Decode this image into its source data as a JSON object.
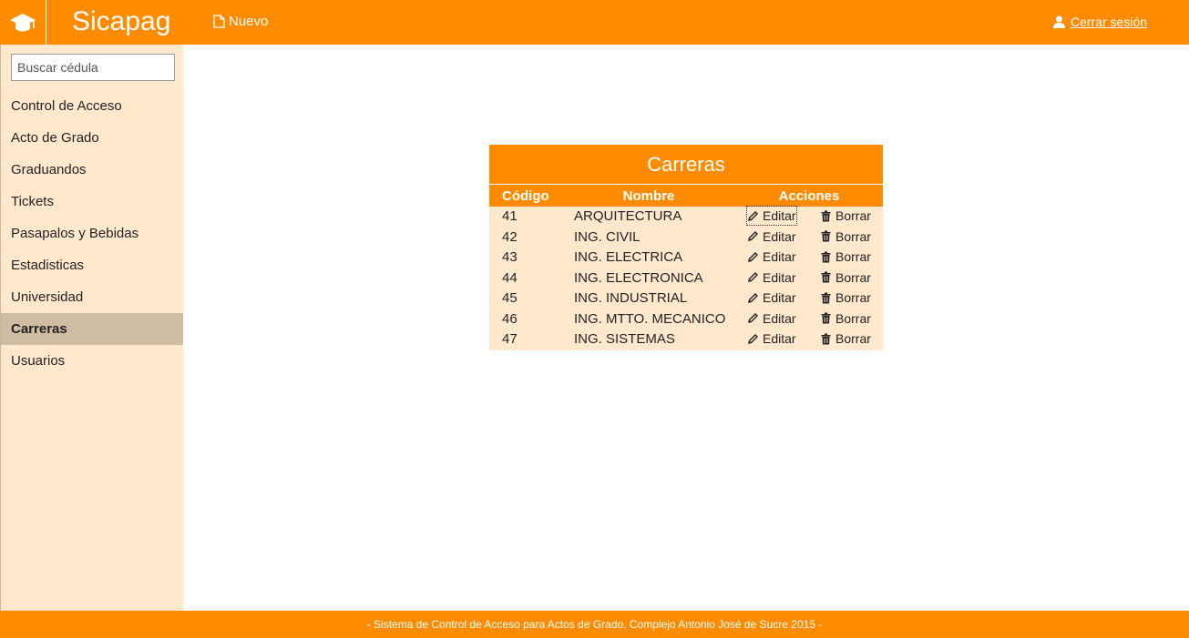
{
  "app": {
    "brand": "Sicapag"
  },
  "header": {
    "new_label": "Nuevo",
    "logout_label": "Cerrar sesión"
  },
  "search": {
    "placeholder": "Buscar cédula",
    "value": ""
  },
  "sidebar": {
    "items": [
      {
        "label": "Control de Acceso",
        "active": false
      },
      {
        "label": "Acto de Grado",
        "active": false
      },
      {
        "label": "Graduandos",
        "active": false
      },
      {
        "label": "Tickets",
        "active": false
      },
      {
        "label": "Pasapalos y Bebidas",
        "active": false
      },
      {
        "label": "Estadisticas",
        "active": false
      },
      {
        "label": "Universidad",
        "active": false
      },
      {
        "label": "Carreras",
        "active": true
      },
      {
        "label": "Usuarios",
        "active": false
      }
    ]
  },
  "table": {
    "title": "Carreras",
    "headers": {
      "code": "Código",
      "name": "Nombre",
      "actions": "Acciones"
    },
    "edit_label": "Editar",
    "delete_label": "Borrar",
    "rows": [
      {
        "code": "41",
        "name": "ARQUITECTURA"
      },
      {
        "code": "42",
        "name": "ING. CIVIL"
      },
      {
        "code": "43",
        "name": "ING. ELECTRICA"
      },
      {
        "code": "44",
        "name": "ING. ELECTRONICA"
      },
      {
        "code": "45",
        "name": "ING. INDUSTRIAL"
      },
      {
        "code": "46",
        "name": "ING. MTTO. MECANICO"
      },
      {
        "code": "47",
        "name": "ING. SISTEMAS"
      }
    ]
  },
  "footer": {
    "text": "- Sistema de Control de Acceso para Actos de Grado, Complejo Antonio José de Sucre 2015 -"
  },
  "colors": {
    "accent": "#ff8c00",
    "sidebar_bg": "#ffe8cc",
    "active_item": "#cfbca3"
  },
  "icons": {
    "logo": "graduation-cap-icon",
    "new": "file-icon",
    "logout": "user-icon",
    "edit": "pencil-icon",
    "delete": "trash-icon"
  }
}
